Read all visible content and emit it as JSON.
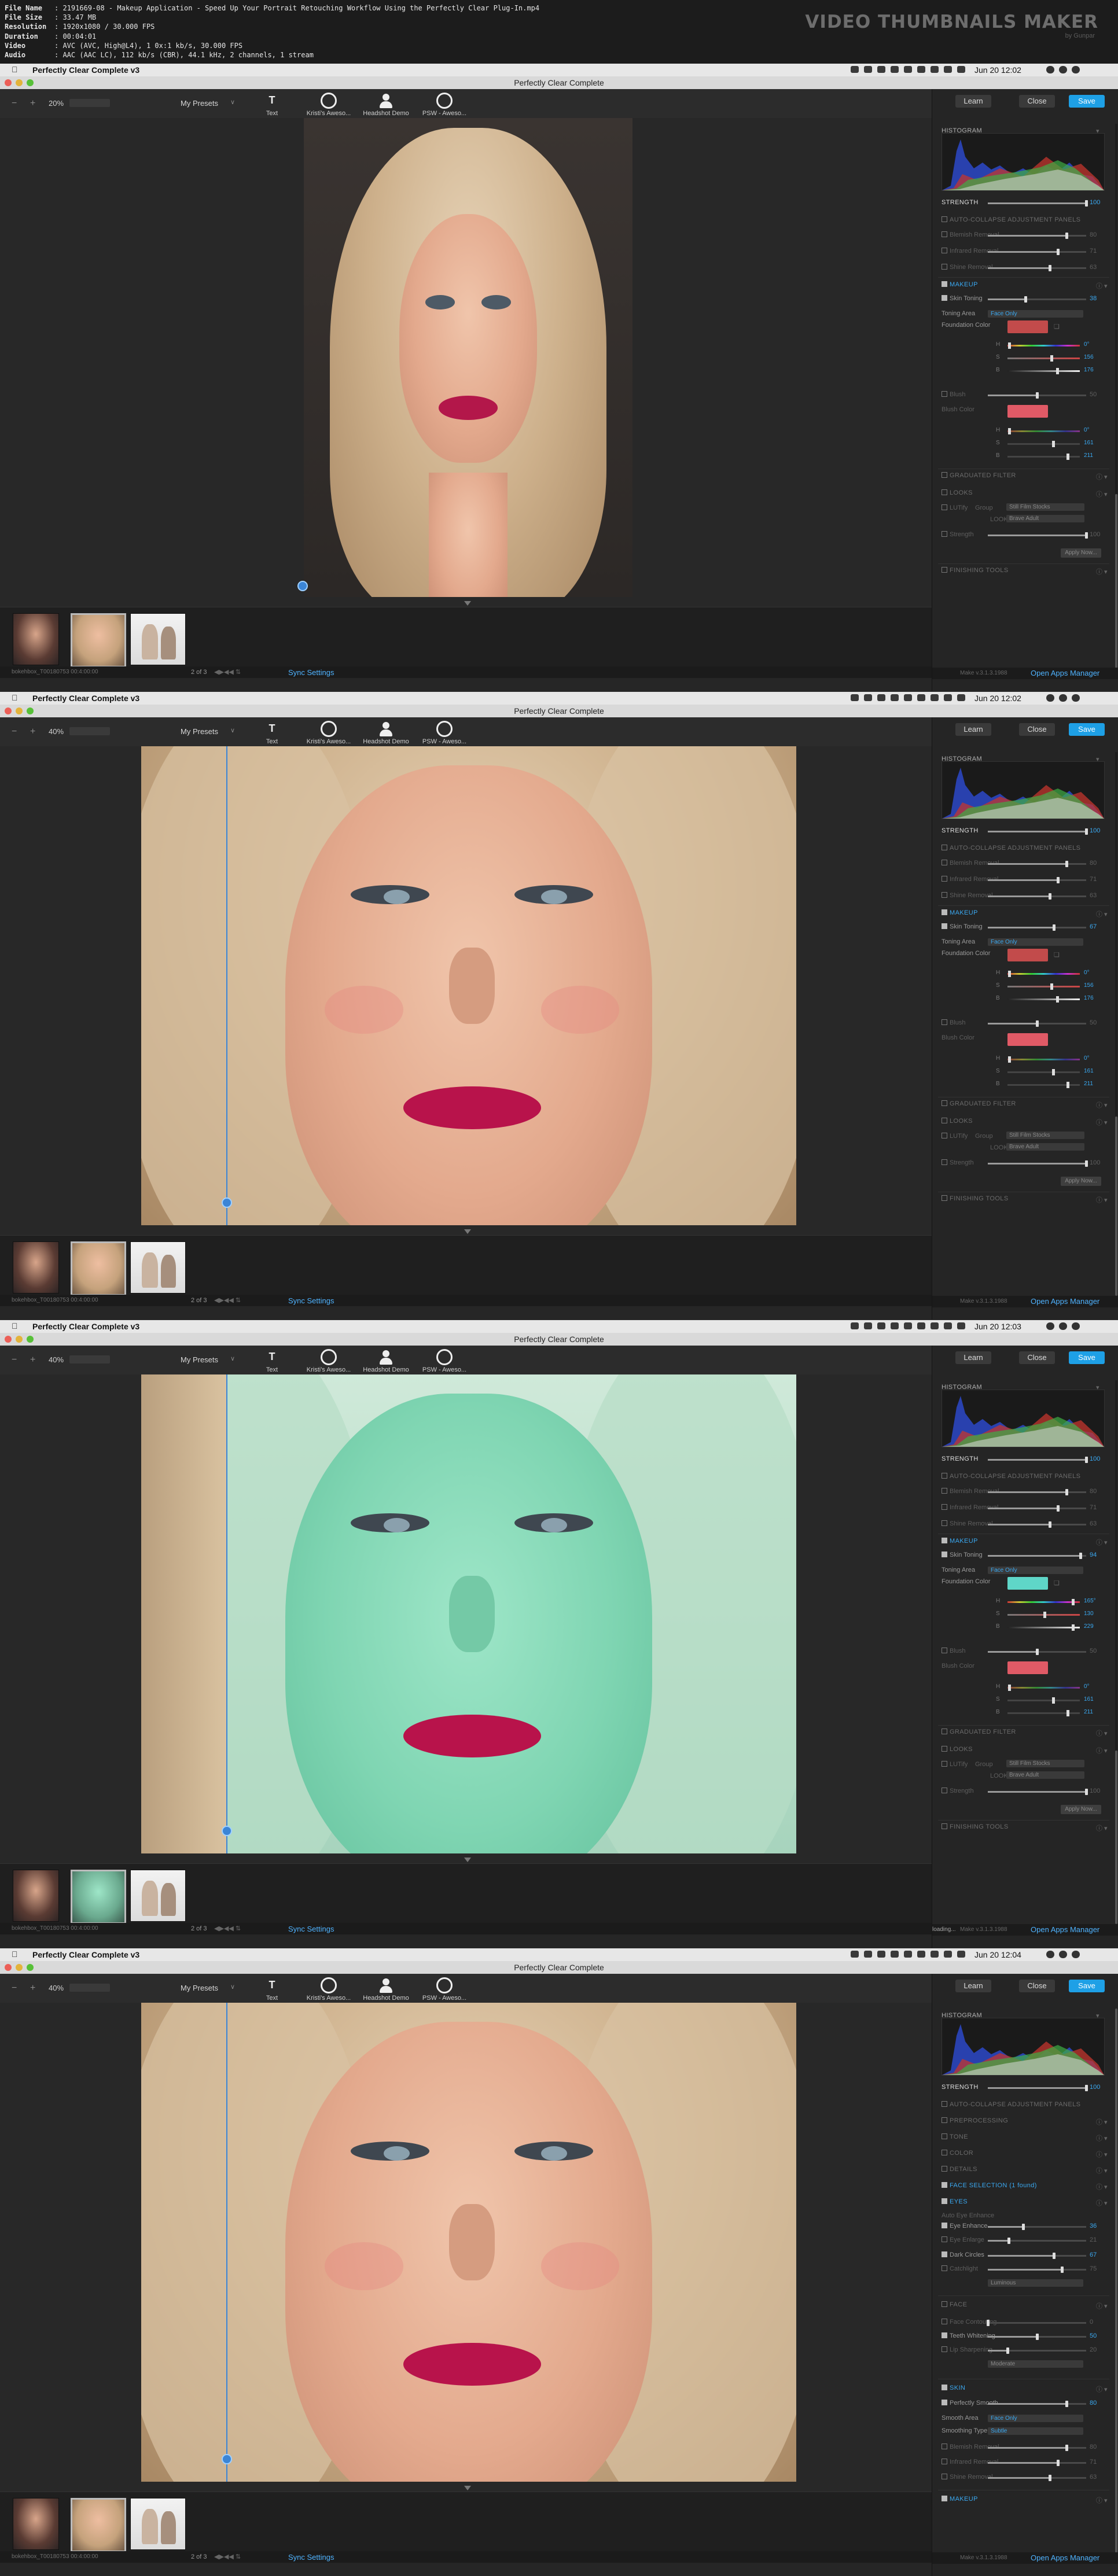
{
  "info": {
    "rows": [
      {
        "k": "File Name",
        "v": ": 2191669-08 - Makeup Application - Speed Up Your Portrait Retouching Workflow Using the Perfectly Clear Plug-In.mp4"
      },
      {
        "k": "File Size",
        "v": ": 33.47 MB"
      },
      {
        "k": "Resolution",
        "v": ": 1920x1080 / 30.000 FPS"
      },
      {
        "k": "Duration",
        "v": ": 00:04:01"
      },
      {
        "k": "Video",
        "v": ": AVC (AVC, High@L4), 1 0x:1 kb/s, 30.000 FPS"
      },
      {
        "k": "Audio",
        "v": ": AAC (AAC LC), 112 kb/s (CBR), 44.1 kHz, 2 channels, 1 stream"
      }
    ],
    "brand": "VIDEO THUMBNAILS MAKER",
    "brand_sub": "by Gunpar"
  },
  "colors": {
    "accent": "#1ea0e6",
    "link": "#4fb3ff",
    "value": "#3aa8f0"
  },
  "frames": [
    {
      "menubar": {
        "app": "Perfectly Clear Complete v3",
        "clock": "Jun 20  12:02"
      },
      "window_title": "Perfectly Clear Complete",
      "zoom": "20%",
      "presets": "My Presets",
      "tools": [
        {
          "label": "Text"
        },
        {
          "label": "Kristi's Aweso..."
        },
        {
          "label": "Headshot Demo"
        },
        {
          "label": "PSW - Aweso..."
        }
      ],
      "buttons": {
        "learn": "Learn",
        "close": "Close",
        "save": "Save"
      },
      "status": {
        "left": "bokehbox_T00180753 00:4:00:00",
        "count": "2 of 3",
        "sync": "Sync Settings",
        "version": "Make v.3.1.3.1988",
        "apps": "Open Apps Manager"
      },
      "panel": {
        "histogram": "HISTOGRAM",
        "strength": "STRENGTH",
        "strength_value": "100",
        "auto": "AUTO-COLLAPSE ADJUSTMENT PANELS",
        "blemish": "Blemish Removal",
        "blemish_v": "80",
        "infrared": "Infrared Removal",
        "infrared_v": "71",
        "shine": "Shine Removal",
        "shine_v": "63",
        "makeup": "MAKEUP",
        "skin_toning": "Skin Toning",
        "skin_toning_v": "38",
        "toning_area": "Toning Area",
        "toning_area_v": "Face Only",
        "foundation": "Foundation Color",
        "r_v": "0°",
        "g_v": "156",
        "b_v": "176",
        "blush": "Blush",
        "blush_v": "50",
        "blush_color": "Blush Color",
        "br_v": "0°",
        "bg_v": "161",
        "bb_v": "211",
        "graduated": "GRADUATED FILTER",
        "looks": "LOOKS",
        "lut_label": "LUTify",
        "lut_group": "Group",
        "lut_group_v": "Still Film Stocks",
        "look_label": "LOOK",
        "look_v": "Brave Adult",
        "strength2": "Strength",
        "strength2_v": "100",
        "apply": "Apply Now...",
        "finishing": "FINISHING TOOLS"
      }
    },
    {
      "menubar": {
        "app": "Perfectly Clear Complete v3",
        "clock": "Jun 20  12:02"
      },
      "window_title": "Perfectly Clear Complete",
      "zoom": "40%",
      "presets": "My Presets",
      "tools": [
        {
          "label": "Text"
        },
        {
          "label": "Kristi's Aweso..."
        },
        {
          "label": "Headshot Demo"
        },
        {
          "label": "PSW - Aweso..."
        }
      ],
      "buttons": {
        "learn": "Learn",
        "close": "Close",
        "save": "Save"
      },
      "status": {
        "left": "bokehbox_T00180753 00:4:00:00",
        "count": "2 of 3",
        "sync": "Sync Settings",
        "version": "Make v.3.1.3.1988",
        "apps": "Open Apps Manager"
      },
      "panel": {
        "histogram": "HISTOGRAM",
        "strength": "STRENGTH",
        "strength_value": "100",
        "auto": "AUTO-COLLAPSE ADJUSTMENT PANELS",
        "blemish": "Blemish Removal",
        "blemish_v": "80",
        "infrared": "Infrared Removal",
        "infrared_v": "71",
        "shine": "Shine Removal",
        "shine_v": "63",
        "makeup": "MAKEUP",
        "skin_toning": "Skin Toning",
        "skin_toning_v": "67",
        "toning_area": "Toning Area",
        "toning_area_v": "Face Only",
        "foundation": "Foundation Color",
        "r_v": "0°",
        "g_v": "156",
        "b_v": "176",
        "blush": "Blush",
        "blush_v": "50",
        "blush_color": "Blush Color",
        "br_v": "0°",
        "bg_v": "161",
        "bb_v": "211",
        "graduated": "GRADUATED FILTER",
        "looks": "LOOKS",
        "lut_label": "LUTify",
        "lut_group": "Group",
        "lut_group_v": "Still Film Stocks",
        "look_label": "LOOK",
        "look_v": "Brave Adult",
        "strength2": "Strength",
        "strength2_v": "100",
        "apply": "Apply Now...",
        "finishing": "FINISHING TOOLS"
      }
    },
    {
      "menubar": {
        "app": "Perfectly Clear Complete v3",
        "clock": "Jun 20  12:03"
      },
      "window_title": "Perfectly Clear Complete",
      "zoom": "40%",
      "presets": "My Presets",
      "tools": [
        {
          "label": "Text"
        },
        {
          "label": "Kristi's Aweso..."
        },
        {
          "label": "Headshot Demo"
        },
        {
          "label": "PSW - Aweso..."
        }
      ],
      "buttons": {
        "learn": "Learn",
        "close": "Close",
        "save": "Save"
      },
      "status": {
        "left": "bokehbox_T00180753 00:4:00:00",
        "count": "2 of 3",
        "sync": "Sync Settings",
        "version": "Make v.3.1.3.1988",
        "apps": "Open Apps Manager",
        "loading": "loading..."
      },
      "panel": {
        "histogram": "HISTOGRAM",
        "strength": "STRENGTH",
        "strength_value": "100",
        "auto": "AUTO-COLLAPSE ADJUSTMENT PANELS",
        "blemish": "Blemish Removal",
        "blemish_v": "80",
        "infrared": "Infrared Removal",
        "infrared_v": "71",
        "shine": "Shine Removal",
        "shine_v": "63",
        "makeup": "MAKEUP",
        "skin_toning": "Skin Toning",
        "skin_toning_v": "94",
        "toning_area": "Toning Area",
        "toning_area_v": "Face Only",
        "foundation": "Foundation Color",
        "r_v": "165°",
        "g_v": "130",
        "b_v": "229",
        "blush": "Blush",
        "blush_v": "50",
        "blush_color": "Blush Color",
        "br_v": "0°",
        "bg_v": "161",
        "bb_v": "211",
        "graduated": "GRADUATED FILTER",
        "looks": "LOOKS",
        "lut_label": "LUTify",
        "lut_group": "Group",
        "lut_group_v": "Still Film Stocks",
        "look_label": "LOOK",
        "look_v": "Brave Adult",
        "strength2": "Strength",
        "strength2_v": "100",
        "apply": "Apply Now...",
        "finishing": "FINISHING TOOLS"
      }
    },
    {
      "menubar": {
        "app": "Perfectly Clear Complete v3",
        "clock": "Jun 20  12:04"
      },
      "window_title": "Perfectly Clear Complete",
      "zoom": "40%",
      "presets": "My Presets",
      "tools": [
        {
          "label": "Text"
        },
        {
          "label": "Kristi's Aweso..."
        },
        {
          "label": "Headshot Demo"
        },
        {
          "label": "PSW - Aweso..."
        }
      ],
      "buttons": {
        "learn": "Learn",
        "close": "Close",
        "save": "Save"
      },
      "status": {
        "left": "bokehbox_T00180753 00:4:00:00",
        "count": "2 of 3",
        "sync": "Sync Settings",
        "version": "Make v.3.1.3.1988",
        "apps": "Open Apps Manager"
      },
      "panel4": {
        "histogram": "HISTOGRAM",
        "strength": "STRENGTH",
        "strength_value": "100",
        "auto": "AUTO-COLLAPSE ADJUSTMENT PANELS",
        "preprocessing": "PREPROCESSING",
        "tone": "TONE",
        "color": "COLOR",
        "details": "DETAILS",
        "face_sel": "FACE SELECTION (1 found)",
        "eyes": "EYES",
        "auto_eye": "Auto Eye Enhance",
        "eye_enh": "Eye Enhance",
        "eye_enh_v": "36",
        "eye_enlarge": "Eye Enlarge",
        "eye_enlarge_v": "21",
        "dark_circles": "Dark Circles",
        "dark_circles_v": "67",
        "catchlight": "Catchlight",
        "catchlight_v": "75",
        "catch_dd": "Luminous",
        "face": "FACE",
        "face_contour": "Face Contouring",
        "face_contour_v": "0",
        "teeth": "Teeth Whitening",
        "teeth_v": "50",
        "lip": "Lip Sharpening",
        "lip_v": "20",
        "lip_dd": "Moderate",
        "skin": "SKIN",
        "smooth": "Perfectly Smooth",
        "smooth_v": "80",
        "smooth_area": "Smooth Area",
        "smooth_area_v": "Face Only",
        "smooth_type": "Smoothing Type",
        "smooth_type_v": "Subtle",
        "blemish": "Blemish Removal",
        "blemish_v": "80",
        "infrared": "Infrared Removal",
        "infrared_v": "71",
        "shine": "Shine Removal",
        "shine_v": "63",
        "makeup": "MAKEUP"
      }
    }
  ]
}
